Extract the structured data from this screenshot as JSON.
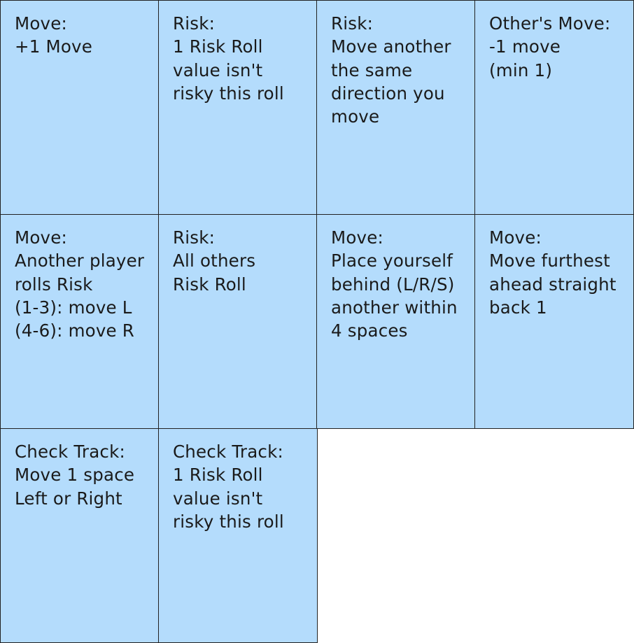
{
  "cards": [
    {
      "title": "Move:",
      "lines": [
        "+1 Move"
      ]
    },
    {
      "title": "Risk:",
      "lines": [
        "1 Risk Roll",
        "value isn't",
        "risky this roll"
      ]
    },
    {
      "title": "Risk:",
      "lines": [
        "Move another",
        "the same",
        "direction you",
        "move"
      ]
    },
    {
      "title": "Other's Move:",
      "lines": [
        "-1 move",
        "(min 1)"
      ]
    },
    {
      "title": "Move:",
      "lines": [
        "Another player",
        "rolls Risk",
        "(1-3): move L",
        "(4-6): move R"
      ]
    },
    {
      "title": "Risk:",
      "lines": [
        "All others",
        "Risk Roll"
      ]
    },
    {
      "title": "Move:",
      "lines": [
        "Place yourself",
        "behind (L/R/S)",
        "another within",
        "4 spaces"
      ]
    },
    {
      "title": "Move:",
      "lines": [
        "Move furthest",
        "ahead straight",
        "back 1"
      ]
    },
    {
      "title": "Check Track:",
      "lines": [
        "Move 1 space",
        "Left or Right"
      ]
    },
    {
      "title": "Check Track:",
      "lines": [
        "1 Risk Roll",
        "value isn't",
        "risky this roll"
      ]
    }
  ]
}
